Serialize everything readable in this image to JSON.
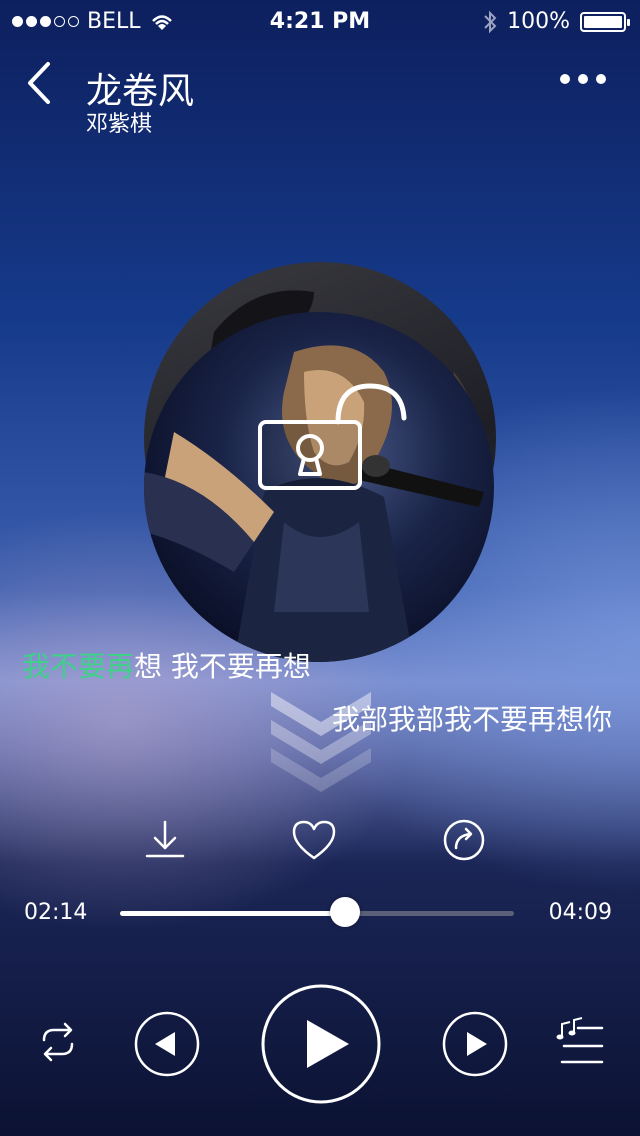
{
  "status_bar": {
    "carrier": "BELL",
    "time": "4:21 PM",
    "battery": "100%",
    "signal_bars_filled": 3,
    "signal_bars_total": 5
  },
  "header": {
    "title": "龙卷风",
    "artist": "邓紫棋"
  },
  "lyrics": {
    "line1_highlight": "我不要再",
    "line1_rest": "想 我不要再想",
    "line2": "我部我部我不要再想你"
  },
  "player": {
    "current_time": "02:14",
    "total_time": "04:09",
    "progress": 0.57
  },
  "colors": {
    "highlight": "#3fd08a",
    "background_top": "#0d1f5e",
    "background_bottom": "#0b1233"
  },
  "icons": {
    "back": "chevron-left-icon",
    "more": "more-dots-icon",
    "lock": "unlock-icon",
    "scroll": "chevron-down-stack-icon",
    "download": "download-icon",
    "favorite": "heart-icon",
    "share": "share-icon",
    "repeat": "repeat-icon",
    "previous": "previous-icon",
    "play": "play-icon",
    "next": "next-icon",
    "playlist": "playlist-icon"
  }
}
